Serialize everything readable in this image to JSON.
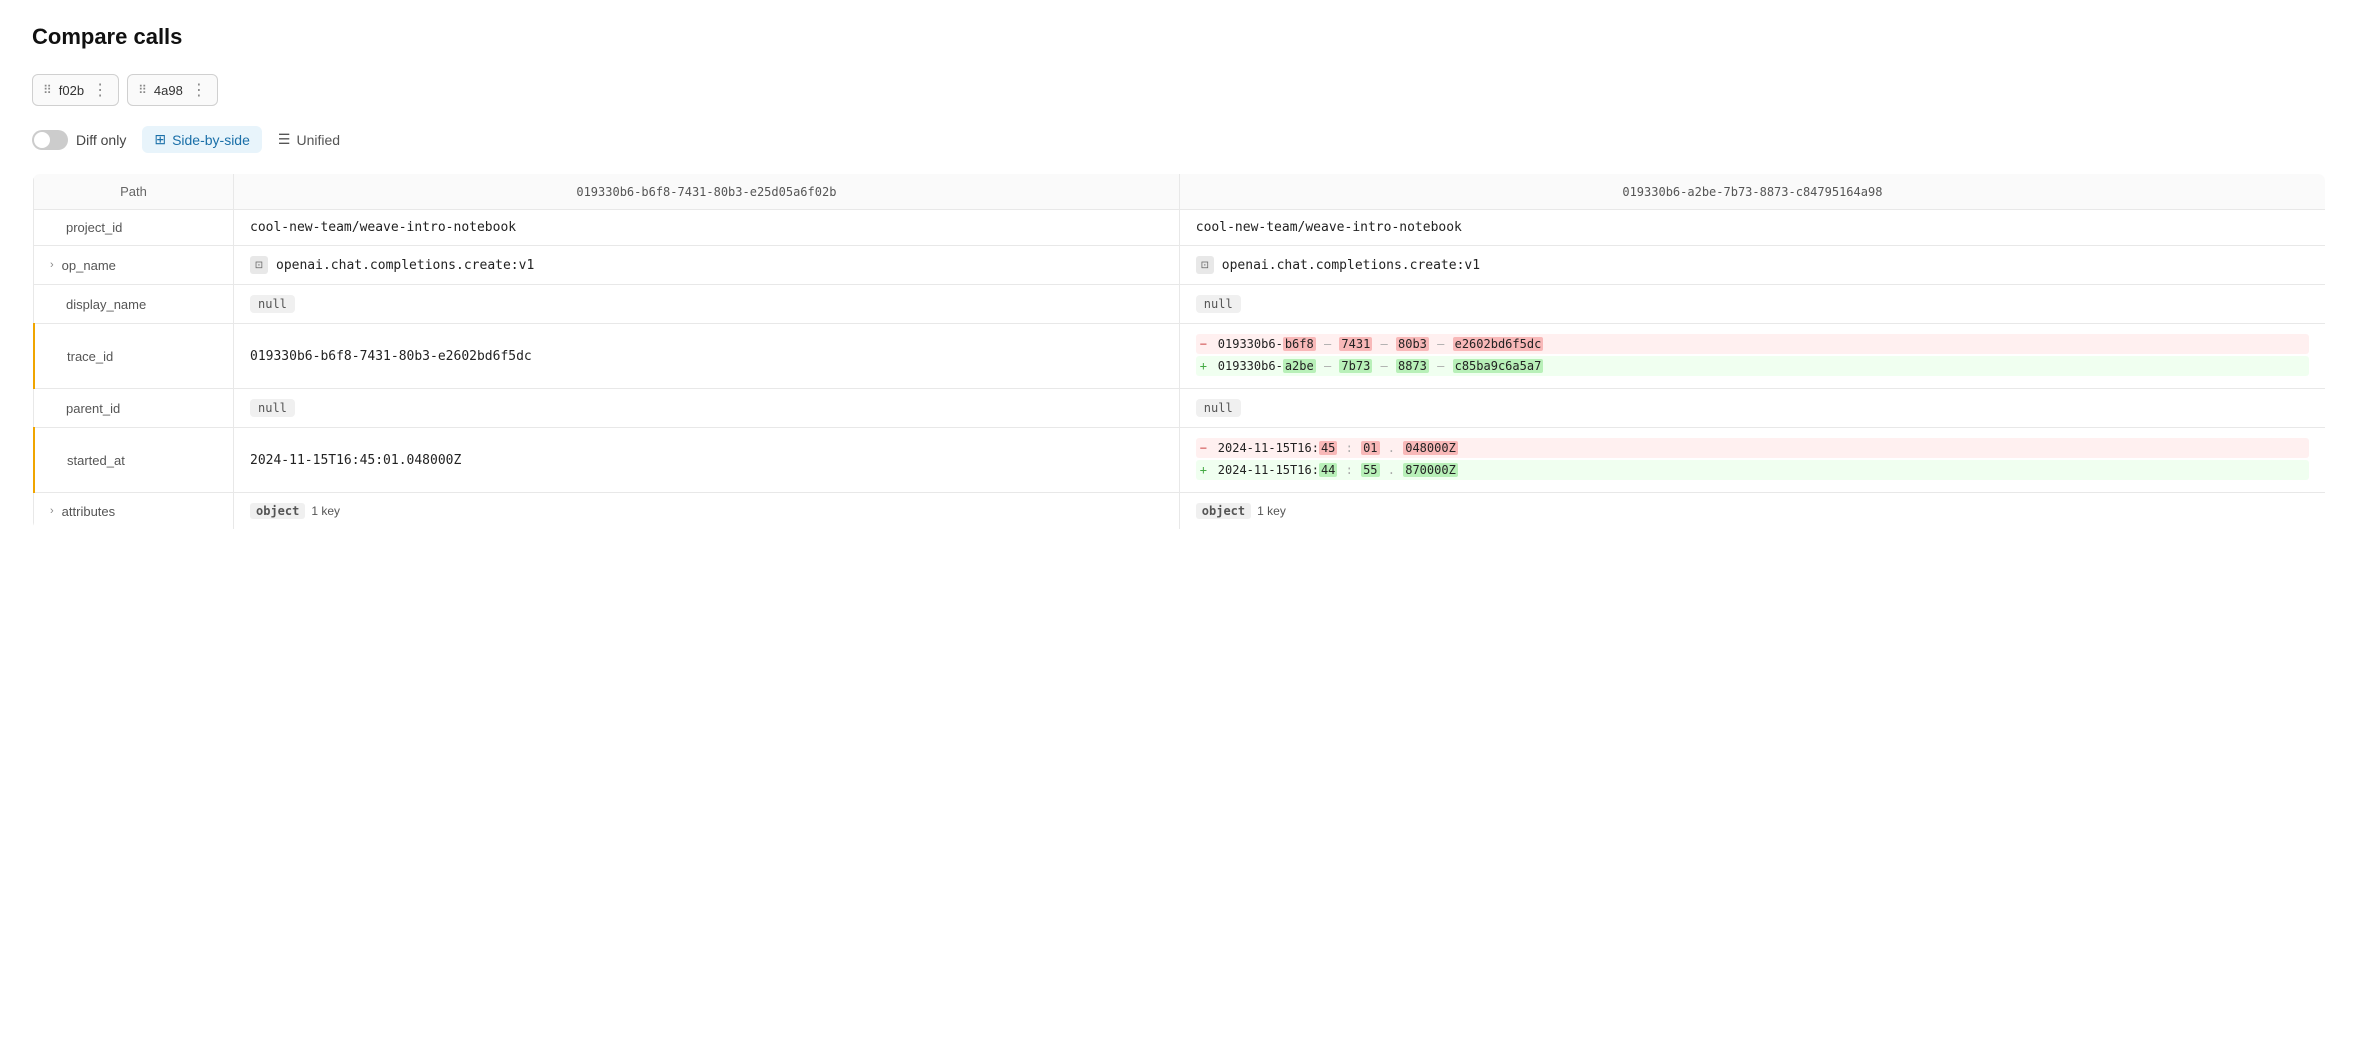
{
  "page": {
    "title": "Compare calls"
  },
  "toolbar": {
    "call1": {
      "id": "f02b",
      "dots": "⠿",
      "more": "⋮"
    },
    "call2": {
      "id": "4a98",
      "dots": "⠿",
      "more": "⋮"
    }
  },
  "view_controls": {
    "diff_only_label": "Diff only",
    "toggle_active": false,
    "tabs": [
      {
        "id": "side-by-side",
        "label": "Side-by-side",
        "icon": "⊞",
        "active": true
      },
      {
        "id": "unified",
        "label": "Unified",
        "icon": "☰",
        "active": false
      }
    ]
  },
  "table": {
    "headers": {
      "path": "Path",
      "col1": "019330b6-b6f8-7431-80b3-e25d05a6f02b",
      "col2": "019330b6-a2be-7b73-8873-c84795164a98"
    },
    "rows": [
      {
        "id": "project_id",
        "label": "project_id",
        "changed": false,
        "expandable": false,
        "col1": {
          "type": "text",
          "value": "cool-new-team/weave-intro-notebook"
        },
        "col2": {
          "type": "text",
          "value": "cool-new-team/weave-intro-notebook"
        }
      },
      {
        "id": "op_name",
        "label": "op_name",
        "changed": false,
        "expandable": true,
        "col1": {
          "type": "opname",
          "value": "openai.chat.completions.create:v1"
        },
        "col2": {
          "type": "opname",
          "value": "openai.chat.completions.create:v1"
        }
      },
      {
        "id": "display_name",
        "label": "display_name",
        "changed": false,
        "expandable": false,
        "col1": {
          "type": "null"
        },
        "col2": {
          "type": "null"
        }
      },
      {
        "id": "trace_id",
        "label": "trace_id",
        "changed": true,
        "expandable": false,
        "col1": {
          "type": "text",
          "value": "019330b6-b6f8-7431-80b3-e2602bd6f5dc"
        },
        "col2": {
          "type": "diff",
          "removed": {
            "prefix": "019330b6-",
            "segments": [
              {
                "text": "b6f8",
                "highlight": true
              },
              {
                "sep": "–"
              },
              {
                "text": "7431",
                "highlight": true
              },
              {
                "sep": "–"
              },
              {
                "text": "80b3",
                "highlight": true
              },
              {
                "sep": "–"
              },
              {
                "text": "e2602bd6f5dc",
                "highlight": true
              }
            ]
          },
          "added": {
            "prefix": "019330b6-",
            "segments": [
              {
                "text": "a2be",
                "highlight": true
              },
              {
                "sep": "–"
              },
              {
                "text": "7b73",
                "highlight": true
              },
              {
                "sep": "–"
              },
              {
                "text": "8873",
                "highlight": true
              },
              {
                "sep": "–"
              },
              {
                "text": "c85ba9c6a5a7",
                "highlight": true
              }
            ]
          }
        }
      },
      {
        "id": "parent_id",
        "label": "parent_id",
        "changed": false,
        "expandable": false,
        "col1": {
          "type": "null"
        },
        "col2": {
          "type": "null"
        }
      },
      {
        "id": "started_at",
        "label": "started_at",
        "changed": true,
        "expandable": false,
        "col1": {
          "type": "text",
          "value": "2024-11-15T16:45:01.048000Z"
        },
        "col2": {
          "type": "diff",
          "removed": {
            "prefix": "2024-11-15T16:",
            "segments": [
              {
                "text": "45",
                "highlight": true
              },
              {
                "sep": ":"
              },
              {
                "text": "01",
                "highlight": true
              },
              {
                "sep": "."
              },
              {
                "text": "048000Z",
                "highlight": true
              }
            ]
          },
          "added": {
            "prefix": "2024-11-15T16:",
            "segments": [
              {
                "text": "44",
                "highlight": true
              },
              {
                "sep": ":"
              },
              {
                "text": "55",
                "highlight": true
              },
              {
                "sep": "."
              },
              {
                "text": "870000Z",
                "highlight": true
              }
            ]
          }
        }
      },
      {
        "id": "attributes",
        "label": "attributes",
        "changed": false,
        "expandable": true,
        "col1": {
          "type": "object",
          "key_count": "1 key"
        },
        "col2": {
          "type": "object",
          "key_count": "1 key"
        }
      }
    ]
  }
}
